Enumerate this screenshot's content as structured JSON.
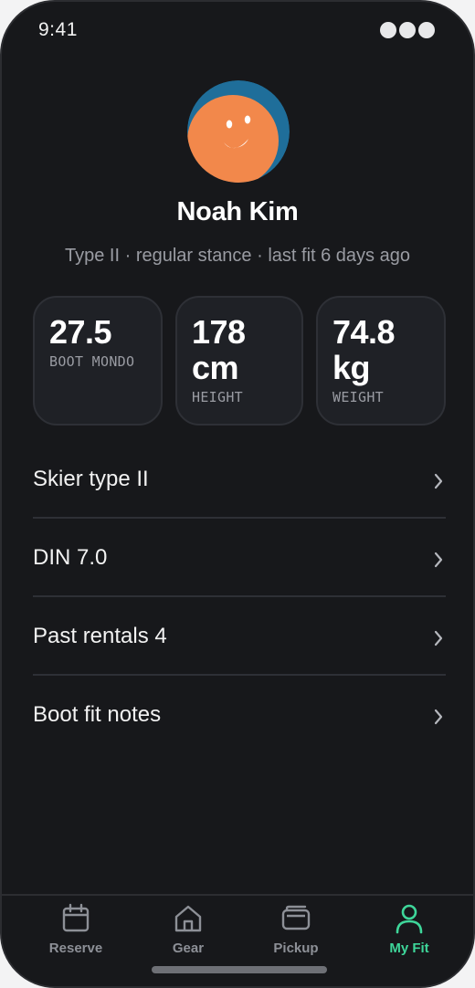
{
  "status_bar": {
    "time": "9:41"
  },
  "profile": {
    "name": "Noah Kim",
    "meta": "Type II · regular stance · last fit 6 days ago",
    "avatar_colors": {
      "background": "#1f6e9a",
      "face": "#f2884b",
      "features": "#ffffff"
    }
  },
  "stats": [
    {
      "value": "27.5",
      "label": "BOOT MONDO"
    },
    {
      "value": "178 cm",
      "label": "HEIGHT"
    },
    {
      "value": "74.8 kg",
      "label": "WEIGHT"
    }
  ],
  "menu": [
    {
      "label": "Skier type II",
      "icon": "chevron-right-icon"
    },
    {
      "label": "DIN 7.0",
      "icon": "chevron-right-icon"
    },
    {
      "label": "Past rentals 4",
      "icon": "chevron-right-icon"
    },
    {
      "label": "Boot fit notes",
      "icon": "chevron-right-icon"
    }
  ],
  "tabs": [
    {
      "label": "Reserve",
      "icon": "calendar-icon",
      "active": false
    },
    {
      "label": "Gear",
      "icon": "home-icon",
      "active": false
    },
    {
      "label": "Pickup",
      "icon": "wallet-icon",
      "active": false
    },
    {
      "label": "My Fit",
      "icon": "person-icon",
      "active": true
    }
  ],
  "colors": {
    "background": "#17181b",
    "card": "#1f2126",
    "accent": "#3ed69a",
    "muted_text": "#9a9ca3"
  }
}
